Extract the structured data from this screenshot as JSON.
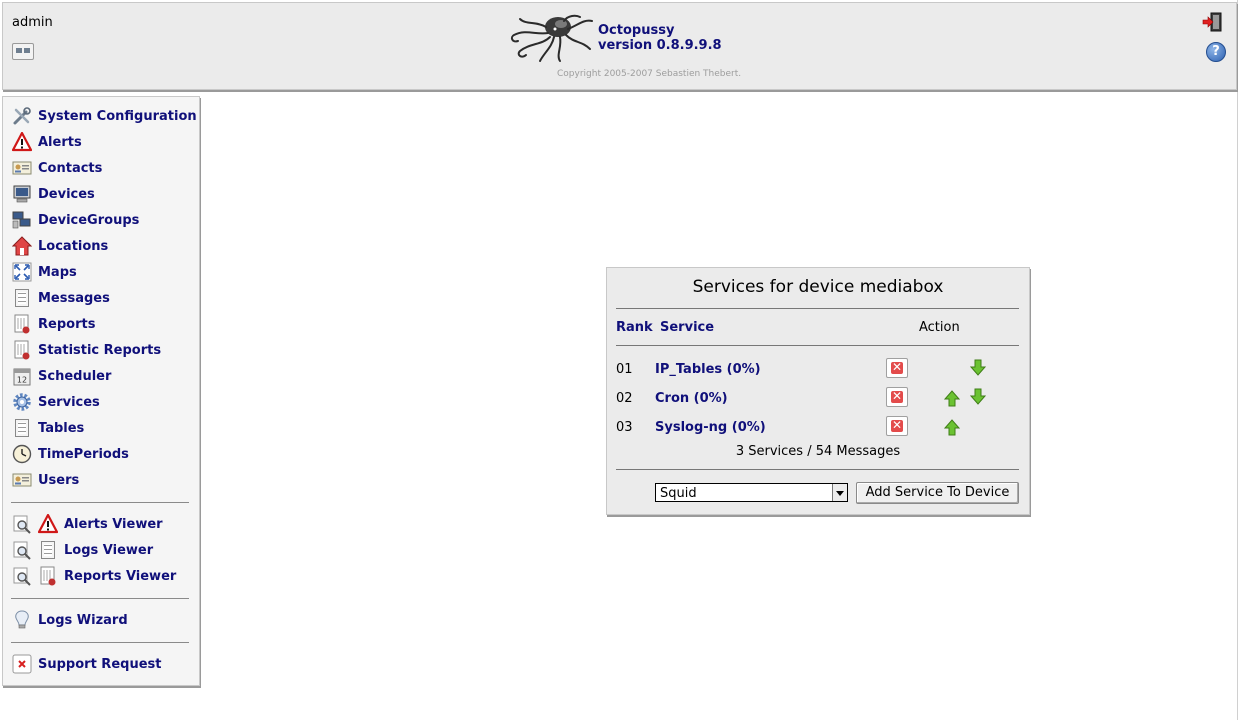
{
  "header": {
    "username": "admin",
    "app_name": "Octopussy",
    "version": "version 0.8.9.9.8",
    "copyright": "Copyright 2005-2007 Sebastien Thebert."
  },
  "sidebar": {
    "items": [
      {
        "label": "System Configuration",
        "icon": "tools-icon"
      },
      {
        "label": "Alerts",
        "icon": "alert-icon"
      },
      {
        "label": "Contacts",
        "icon": "contact-card-icon"
      },
      {
        "label": "Devices",
        "icon": "computer-icon"
      },
      {
        "label": "DeviceGroups",
        "icon": "device-group-icon"
      },
      {
        "label": "Locations",
        "icon": "home-icon"
      },
      {
        "label": "Maps",
        "icon": "map-icon"
      },
      {
        "label": "Messages",
        "icon": "document-icon"
      },
      {
        "label": "Reports",
        "icon": "report-icon"
      },
      {
        "label": "Statistic Reports",
        "icon": "statistic-report-icon"
      },
      {
        "label": "Scheduler",
        "icon": "calendar-icon"
      },
      {
        "label": "Services",
        "icon": "gear-icon"
      },
      {
        "label": "Tables",
        "icon": "table-icon"
      },
      {
        "label": "TimePeriods",
        "icon": "clock-icon"
      },
      {
        "label": "Users",
        "icon": "user-card-icon"
      }
    ],
    "viewers": [
      {
        "label": "Alerts Viewer"
      },
      {
        "label": "Logs Viewer"
      },
      {
        "label": "Reports Viewer"
      }
    ],
    "wizard": {
      "label": "Logs Wizard"
    },
    "support": {
      "label": "Support Request"
    }
  },
  "panel": {
    "title": "Services for device mediabox",
    "col_rank": "Rank",
    "col_service": "Service",
    "col_action": "Action",
    "services": [
      {
        "rank": "01",
        "name": "IP_Tables (0%)",
        "up": false,
        "down": true
      },
      {
        "rank": "02",
        "name": "Cron (0%)",
        "up": true,
        "down": true
      },
      {
        "rank": "03",
        "name": "Syslog-ng (0%)",
        "up": true,
        "down": false
      }
    ],
    "summary": "3 Services / 54 Messages",
    "select_value": "Squid",
    "add_button": "Add Service To Device"
  },
  "colors": {
    "link": "#10107a",
    "panel_bg": "#ebebeb",
    "delete_red": "#e34b4b",
    "arrow_green": "#5cb82a"
  }
}
